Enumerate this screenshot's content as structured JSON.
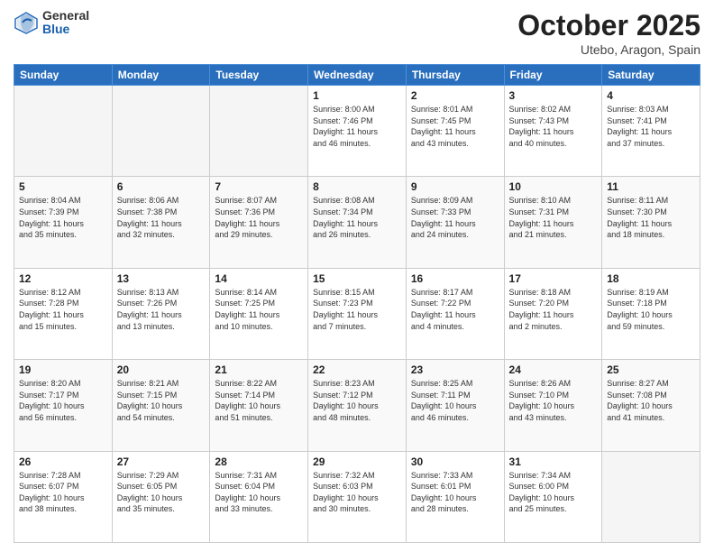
{
  "header": {
    "logo_general": "General",
    "logo_blue": "Blue",
    "month": "October 2025",
    "location": "Utebo, Aragon, Spain"
  },
  "weekdays": [
    "Sunday",
    "Monday",
    "Tuesday",
    "Wednesday",
    "Thursday",
    "Friday",
    "Saturday"
  ],
  "weeks": [
    [
      {
        "day": "",
        "info": ""
      },
      {
        "day": "",
        "info": ""
      },
      {
        "day": "",
        "info": ""
      },
      {
        "day": "1",
        "info": "Sunrise: 8:00 AM\nSunset: 7:46 PM\nDaylight: 11 hours\nand 46 minutes."
      },
      {
        "day": "2",
        "info": "Sunrise: 8:01 AM\nSunset: 7:45 PM\nDaylight: 11 hours\nand 43 minutes."
      },
      {
        "day": "3",
        "info": "Sunrise: 8:02 AM\nSunset: 7:43 PM\nDaylight: 11 hours\nand 40 minutes."
      },
      {
        "day": "4",
        "info": "Sunrise: 8:03 AM\nSunset: 7:41 PM\nDaylight: 11 hours\nand 37 minutes."
      }
    ],
    [
      {
        "day": "5",
        "info": "Sunrise: 8:04 AM\nSunset: 7:39 PM\nDaylight: 11 hours\nand 35 minutes."
      },
      {
        "day": "6",
        "info": "Sunrise: 8:06 AM\nSunset: 7:38 PM\nDaylight: 11 hours\nand 32 minutes."
      },
      {
        "day": "7",
        "info": "Sunrise: 8:07 AM\nSunset: 7:36 PM\nDaylight: 11 hours\nand 29 minutes."
      },
      {
        "day": "8",
        "info": "Sunrise: 8:08 AM\nSunset: 7:34 PM\nDaylight: 11 hours\nand 26 minutes."
      },
      {
        "day": "9",
        "info": "Sunrise: 8:09 AM\nSunset: 7:33 PM\nDaylight: 11 hours\nand 24 minutes."
      },
      {
        "day": "10",
        "info": "Sunrise: 8:10 AM\nSunset: 7:31 PM\nDaylight: 11 hours\nand 21 minutes."
      },
      {
        "day": "11",
        "info": "Sunrise: 8:11 AM\nSunset: 7:30 PM\nDaylight: 11 hours\nand 18 minutes."
      }
    ],
    [
      {
        "day": "12",
        "info": "Sunrise: 8:12 AM\nSunset: 7:28 PM\nDaylight: 11 hours\nand 15 minutes."
      },
      {
        "day": "13",
        "info": "Sunrise: 8:13 AM\nSunset: 7:26 PM\nDaylight: 11 hours\nand 13 minutes."
      },
      {
        "day": "14",
        "info": "Sunrise: 8:14 AM\nSunset: 7:25 PM\nDaylight: 11 hours\nand 10 minutes."
      },
      {
        "day": "15",
        "info": "Sunrise: 8:15 AM\nSunset: 7:23 PM\nDaylight: 11 hours\nand 7 minutes."
      },
      {
        "day": "16",
        "info": "Sunrise: 8:17 AM\nSunset: 7:22 PM\nDaylight: 11 hours\nand 4 minutes."
      },
      {
        "day": "17",
        "info": "Sunrise: 8:18 AM\nSunset: 7:20 PM\nDaylight: 11 hours\nand 2 minutes."
      },
      {
        "day": "18",
        "info": "Sunrise: 8:19 AM\nSunset: 7:18 PM\nDaylight: 10 hours\nand 59 minutes."
      }
    ],
    [
      {
        "day": "19",
        "info": "Sunrise: 8:20 AM\nSunset: 7:17 PM\nDaylight: 10 hours\nand 56 minutes."
      },
      {
        "day": "20",
        "info": "Sunrise: 8:21 AM\nSunset: 7:15 PM\nDaylight: 10 hours\nand 54 minutes."
      },
      {
        "day": "21",
        "info": "Sunrise: 8:22 AM\nSunset: 7:14 PM\nDaylight: 10 hours\nand 51 minutes."
      },
      {
        "day": "22",
        "info": "Sunrise: 8:23 AM\nSunset: 7:12 PM\nDaylight: 10 hours\nand 48 minutes."
      },
      {
        "day": "23",
        "info": "Sunrise: 8:25 AM\nSunset: 7:11 PM\nDaylight: 10 hours\nand 46 minutes."
      },
      {
        "day": "24",
        "info": "Sunrise: 8:26 AM\nSunset: 7:10 PM\nDaylight: 10 hours\nand 43 minutes."
      },
      {
        "day": "25",
        "info": "Sunrise: 8:27 AM\nSunset: 7:08 PM\nDaylight: 10 hours\nand 41 minutes."
      }
    ],
    [
      {
        "day": "26",
        "info": "Sunrise: 7:28 AM\nSunset: 6:07 PM\nDaylight: 10 hours\nand 38 minutes."
      },
      {
        "day": "27",
        "info": "Sunrise: 7:29 AM\nSunset: 6:05 PM\nDaylight: 10 hours\nand 35 minutes."
      },
      {
        "day": "28",
        "info": "Sunrise: 7:31 AM\nSunset: 6:04 PM\nDaylight: 10 hours\nand 33 minutes."
      },
      {
        "day": "29",
        "info": "Sunrise: 7:32 AM\nSunset: 6:03 PM\nDaylight: 10 hours\nand 30 minutes."
      },
      {
        "day": "30",
        "info": "Sunrise: 7:33 AM\nSunset: 6:01 PM\nDaylight: 10 hours\nand 28 minutes."
      },
      {
        "day": "31",
        "info": "Sunrise: 7:34 AM\nSunset: 6:00 PM\nDaylight: 10 hours\nand 25 minutes."
      },
      {
        "day": "",
        "info": ""
      }
    ]
  ]
}
